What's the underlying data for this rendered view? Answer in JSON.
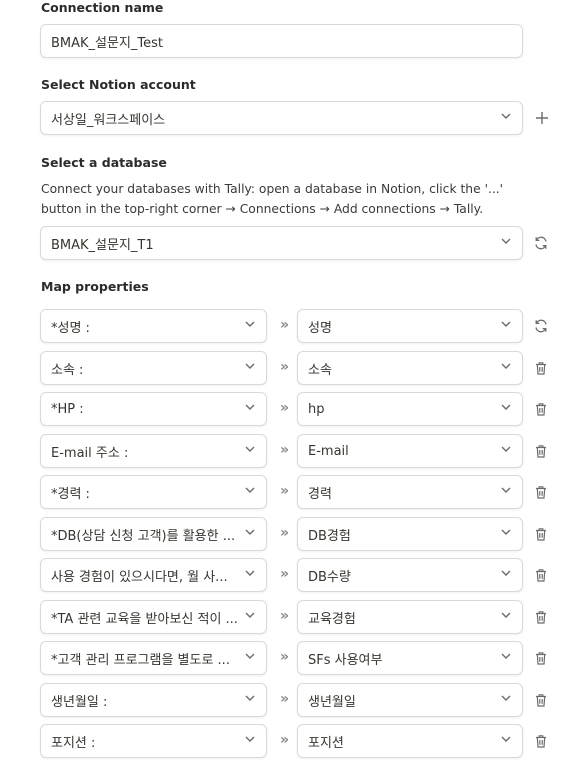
{
  "connection": {
    "label": "Connection name",
    "value": "BMAK_설문지_Test"
  },
  "account": {
    "label": "Select Notion account",
    "selected": "서상일_워크스페이스"
  },
  "database": {
    "label": "Select a database",
    "help_line1": "Connect your databases with Tally: open a database in Notion, click the '...'",
    "help_line2": "button in the top-right corner → Connections → Add connections → Tally.",
    "selected": "BMAK_설문지_T1"
  },
  "map": {
    "label": "Map properties",
    "arrow": "»",
    "rows": [
      {
        "field": "*성명 :",
        "property": "성명",
        "action": "refresh-icon"
      },
      {
        "field": "소속 :",
        "property": "소속",
        "action": "trash-icon"
      },
      {
        "field": "*HP :",
        "property": "hp",
        "action": "trash-icon"
      },
      {
        "field": "E-mail 주소 :",
        "property": "E-mail",
        "action": "trash-icon"
      },
      {
        "field": "*경력 :",
        "property": "경력",
        "action": "trash-icon"
      },
      {
        "field": "*DB(상담 신청 고객)를 활용한 ...",
        "property": "DB경험",
        "action": "trash-icon"
      },
      {
        "field": "사용 경험이 있으시다면, 월 사...",
        "property": "DB수량",
        "action": "trash-icon"
      },
      {
        "field": "*TA 관련 교육을 받아보신 적이 ...",
        "property": "교육경험",
        "action": "trash-icon"
      },
      {
        "field": "*고객 관리 프로그램을 별도로 ...",
        "property": "SFs 사용여부",
        "action": "trash-icon"
      },
      {
        "field": "생년월일 :",
        "property": "생년월일",
        "action": "trash-icon"
      },
      {
        "field": "포지션 :",
        "property": "포지션",
        "action": "trash-icon"
      }
    ]
  }
}
